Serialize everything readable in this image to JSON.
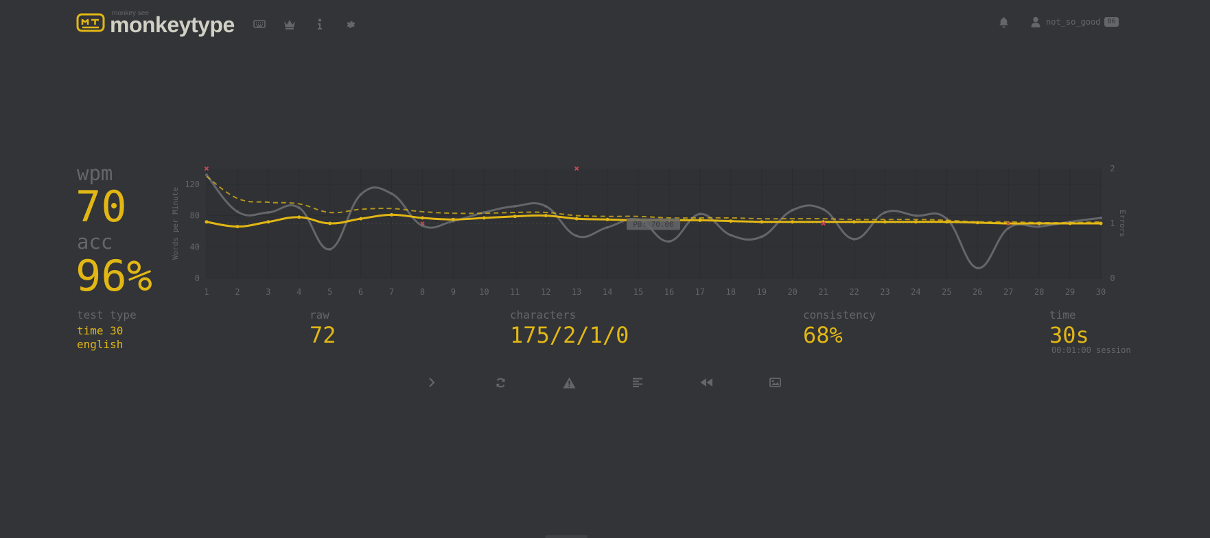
{
  "header": {
    "logo_sub": "monkey see",
    "logo_text": "monkeytype",
    "nav_icons": [
      "keyboard-icon",
      "crown-icon",
      "info-icon",
      "gear-icon"
    ],
    "notification_icon": "bell-icon",
    "account_icon": "user-icon",
    "username": "not_so_good",
    "level": "86"
  },
  "result": {
    "wpm_label": "wpm",
    "wpm": "70",
    "acc_label": "acc",
    "acc": "96%",
    "test_type_label": "test type",
    "test_type_mode": "time 30",
    "test_type_language": "english",
    "raw_label": "raw",
    "raw": "72",
    "characters_label": "characters",
    "characters": "175/2/1/0",
    "consistency_label": "consistency",
    "consistency": "68%",
    "time_label": "time",
    "time": "30s",
    "session": "00:01:00 session"
  },
  "buttons": [
    "next-test-icon",
    "restart-icon",
    "report-icon",
    "word-history-icon",
    "replay-icon",
    "screenshot-icon"
  ],
  "colors": {
    "background": "#323437",
    "main": "#e2b714",
    "sub": "#646669",
    "text": "#d1d0c5",
    "error": "#ca4754"
  },
  "chart_data": {
    "type": "line",
    "x": [
      1,
      2,
      3,
      4,
      5,
      6,
      7,
      8,
      9,
      10,
      11,
      12,
      13,
      14,
      15,
      16,
      17,
      18,
      19,
      20,
      21,
      22,
      23,
      24,
      25,
      26,
      27,
      28,
      29,
      30
    ],
    "ylabel": "Words per Minute",
    "ylim": [
      0,
      140
    ],
    "y_ticks": [
      0,
      40,
      80,
      120
    ],
    "y2label": "Errors",
    "y2lim": [
      0,
      2
    ],
    "y2_ticks": [
      0,
      1,
      2
    ],
    "pb_label": "PB: 70.00",
    "pb_value": 70,
    "series": [
      {
        "role": "wpm",
        "color": "#e2b714",
        "values": [
          72,
          66,
          72,
          78,
          70,
          76,
          81,
          77,
          75,
          77,
          79,
          80,
          76,
          75,
          74,
          74,
          74,
          73,
          72,
          72,
          72,
          72,
          72,
          72,
          72,
          71,
          70,
          70,
          70,
          70
        ]
      },
      {
        "role": "raw",
        "color": "#646669",
        "values": [
          132,
          85,
          84,
          90,
          37,
          107,
          108,
          67,
          73,
          84,
          92,
          92,
          54,
          65,
          75,
          47,
          82,
          55,
          53,
          87,
          88,
          50,
          84,
          80,
          76,
          13,
          64,
          66,
          72,
          77
        ]
      },
      {
        "role": "burst-trend",
        "color": "#e2b714",
        "dashed": true,
        "values": [
          130,
          102,
          97,
          95,
          84,
          88,
          89,
          85,
          83,
          83,
          84,
          84,
          80,
          79,
          79,
          77,
          77,
          77,
          76,
          76,
          76,
          75,
          75,
          75,
          74,
          72,
          72,
          71,
          71,
          72
        ]
      },
      {
        "role": "errors",
        "color": "#ca4754",
        "points": [
          [
            1,
            2
          ],
          [
            8,
            1
          ],
          [
            13,
            2
          ],
          [
            21,
            1
          ],
          [
            27,
            1
          ]
        ]
      }
    ]
  }
}
